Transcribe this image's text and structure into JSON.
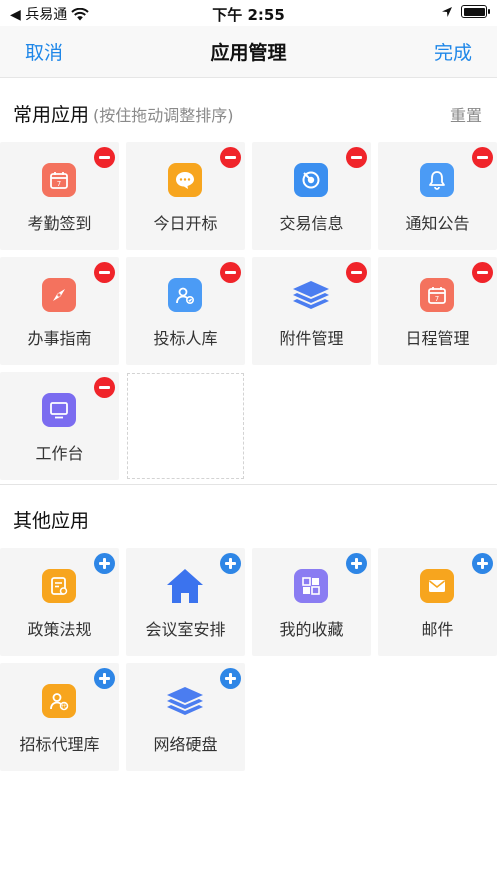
{
  "status_bar": {
    "back_app": "◀ 兵易通",
    "time": "下午 2:55"
  },
  "nav": {
    "cancel": "取消",
    "title": "应用管理",
    "done": "完成"
  },
  "common_section": {
    "title": "常用应用",
    "hint": "(按住拖动调整排序)",
    "reset": "重置"
  },
  "common_apps": [
    {
      "label": "考勤签到",
      "icon": "calendar-icon",
      "color": "#f4725e"
    },
    {
      "label": "今日开标",
      "icon": "chat-bubble-icon",
      "color": "#f7a51e"
    },
    {
      "label": "交易信息",
      "icon": "target-icon",
      "color": "#3b8ff0"
    },
    {
      "label": "通知公告",
      "icon": "bell-icon",
      "color": "#4b9bf5"
    },
    {
      "label": "办事指南",
      "icon": "compass-icon",
      "color": "#f4725e"
    },
    {
      "label": "投标人库",
      "icon": "person-icon",
      "color": "#4b9bf5"
    },
    {
      "label": "附件管理",
      "icon": "layers-icon",
      "color": "#4b7df0"
    },
    {
      "label": "日程管理",
      "icon": "calendar-icon",
      "color": "#f4725e"
    },
    {
      "label": "工作台",
      "icon": "monitor-icon",
      "color": "#7b6cf0"
    }
  ],
  "other_section": {
    "title": "其他应用"
  },
  "other_apps": [
    {
      "label": "政策法规",
      "icon": "document-icon",
      "color": "#f7a51e"
    },
    {
      "label": "会议室安排",
      "icon": "house-icon",
      "color": "#3b73ee"
    },
    {
      "label": "我的收藏",
      "icon": "grid-icon",
      "color": "#8a7cf2"
    },
    {
      "label": "邮件",
      "icon": "envelope-icon",
      "color": "#f7a51e"
    },
    {
      "label": "招标代理库",
      "icon": "agent-icon",
      "color": "#f7a51e"
    },
    {
      "label": "网络硬盘",
      "icon": "layers-icon",
      "color": "#4b7df0"
    }
  ]
}
